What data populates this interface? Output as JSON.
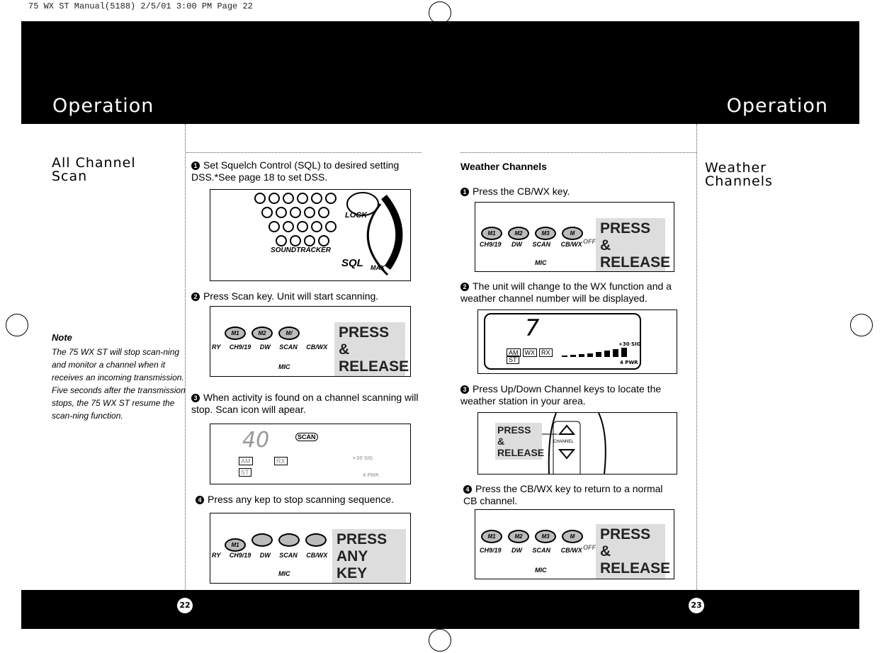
{
  "slug": "75 WX ST Manual(5188)  2/5/01  3:00 PM  Page 22",
  "left": {
    "header_title": "Operation",
    "section_title": "All Channel Scan",
    "note": {
      "heading": "Note",
      "text": "The 75 WX ST will stop scan-ning and monitor a channel when it receives an incoming transmission. Five seconds after the transmission stops, the 75 WX ST resume the scan-ning function."
    },
    "steps": [
      {
        "num": "1",
        "text": "Set Squelch Control (SQL) to desired setting DSS.*See page 18 to set DSS."
      },
      {
        "num": "2",
        "text": "Press Scan key. Unit will start scanning."
      },
      {
        "num": "3",
        "text": "When activity is found on a channel scanning will stop. Scan icon will apear."
      },
      {
        "num": "4",
        "text": "Press any kep to stop scanning sequence."
      }
    ],
    "fig1": {
      "lock": "LOCK",
      "sql": "SQL",
      "max": "MAX",
      "brand": "SOUNDTRACKER"
    },
    "fig2": {
      "keys": [
        "M1",
        "M2",
        "M/"
      ],
      "labels": [
        "RY",
        "CH9/19",
        "DW",
        "SCAN",
        "CB/WX"
      ],
      "mic": "MIC",
      "callout": "PRESS & RELEASE"
    },
    "fig3": {
      "channel": "40",
      "scan": "SCAN",
      "am": "AM",
      "st": "ST",
      "rx": "RX",
      "sig": "+30 SIG",
      "pwr": "4 PWR"
    },
    "fig4": {
      "keys": [
        "M1",
        "",
        "",
        ""
      ],
      "labels": [
        "RY",
        "CH9/19",
        "DW",
        "SCAN",
        "CB/WX"
      ],
      "mic": "MIC",
      "callout": "PRESS ANY KEY"
    },
    "page_number": "22"
  },
  "right": {
    "header_title": "Operation",
    "section_title": "Weather Channels",
    "subheading": "Weather Channels",
    "steps": [
      {
        "num": "1",
        "text": "Press the CB/WX key."
      },
      {
        "num": "2",
        "text": "The unit will change to the WX function and a weather channel number will be displayed."
      },
      {
        "num": "3",
        "text": "Press Up/Down Channel keys to locate the weather station in your area."
      },
      {
        "num": "4",
        "text": "Press the CB/WX key to return to a normal CB channel."
      }
    ],
    "fig1": {
      "keys": [
        "M1",
        "M2",
        "M3",
        "M"
      ],
      "labels": [
        "CH9/19",
        "DW",
        "SCAN",
        "CB/WX"
      ],
      "mic": "MIC",
      "off": "OFF",
      "callout": "PRESS & RELEASE"
    },
    "fig2": {
      "channel": "7",
      "am": "AM",
      "wx": "WX",
      "rx": "RX",
      "st": "ST",
      "sig": "+30 SIG",
      "pwr": "4 PWR"
    },
    "fig3": {
      "callout": "PRESS & RELEASE",
      "channel_label": "CHANNEL"
    },
    "fig4": {
      "keys": [
        "M1",
        "M2",
        "M3",
        "M"
      ],
      "labels": [
        "CH9/19",
        "DW",
        "SCAN",
        "CB/WX"
      ],
      "mic": "MIC",
      "off": "OFF",
      "callout": "PRESS & RELEASE"
    },
    "page_number": "23"
  }
}
